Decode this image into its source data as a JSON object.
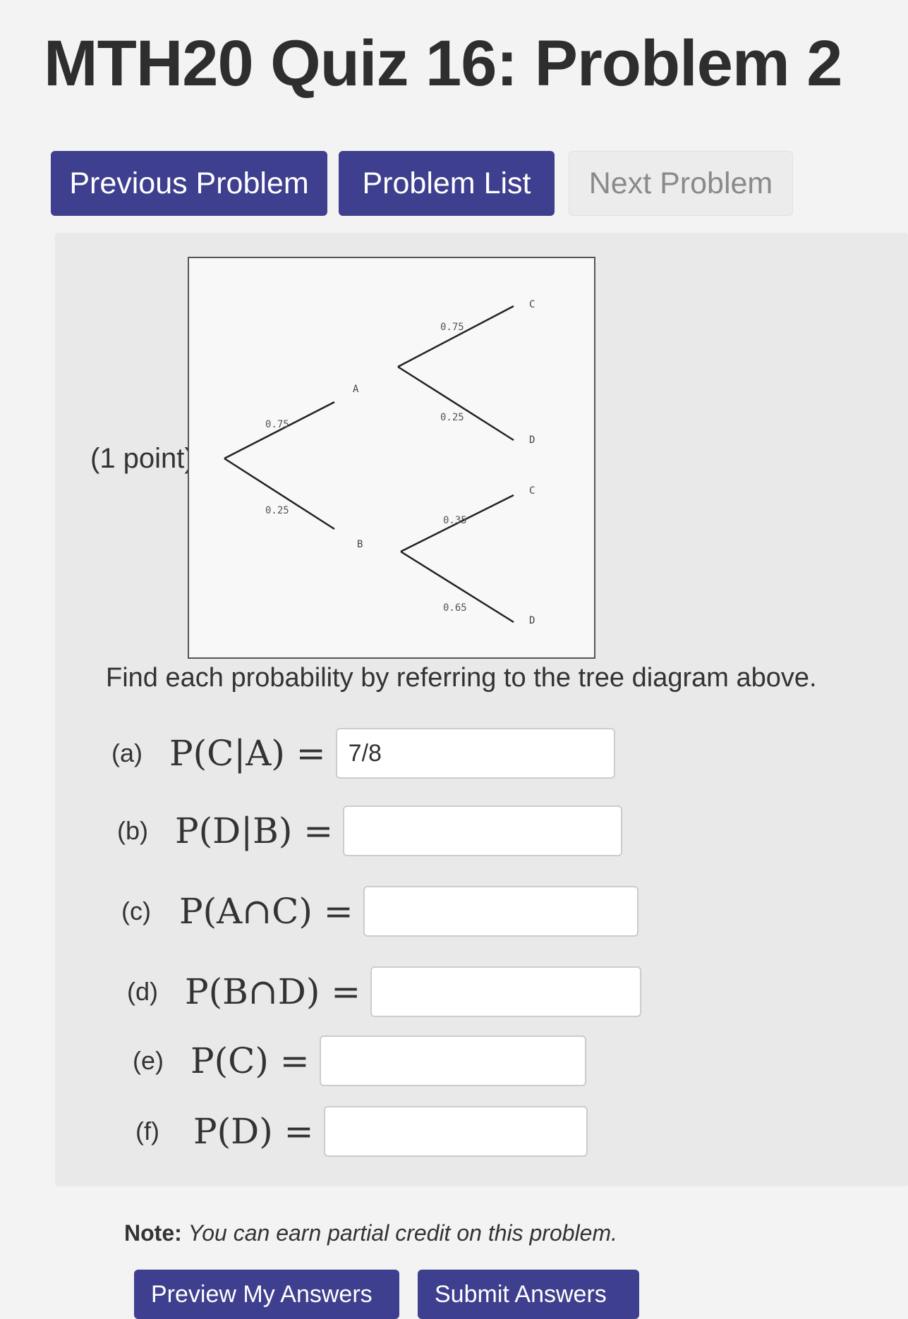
{
  "page": {
    "title": "MTH20 Quiz 16: Problem 2"
  },
  "nav": {
    "previous_label": "Previous Problem",
    "list_label": "Problem List",
    "next_label": "Next Problem"
  },
  "problem": {
    "points": "(1 point)",
    "prompt": "Find each probability by referring to the tree diagram above.",
    "tree": {
      "first_level": [
        {
          "node": "A",
          "prob": "0.75"
        },
        {
          "node": "B",
          "prob": "0.25"
        }
      ],
      "second_level_A": [
        {
          "node": "C",
          "prob": "0.75"
        },
        {
          "node": "D",
          "prob": "0.25"
        }
      ],
      "second_level_B": [
        {
          "node": "C",
          "prob": "0.35"
        },
        {
          "node": "D",
          "prob": "0.65"
        }
      ]
    },
    "questions": [
      {
        "label": "(a)",
        "expr": "P(C|A) =",
        "value": "7/8"
      },
      {
        "label": "(b)",
        "expr": "P(D|B) =",
        "value": ""
      },
      {
        "label": "(c)",
        "expr": "P(A∩C) =",
        "value": ""
      },
      {
        "label": "(d)",
        "expr": "P(B∩D) =",
        "value": ""
      },
      {
        "label": "(e)",
        "expr": "P(C) =",
        "value": ""
      },
      {
        "label": "(f)",
        "expr": "P(D) =",
        "value": ""
      }
    ]
  },
  "note": {
    "label": "Note:",
    "text": "You can earn partial credit on this problem."
  },
  "buttons": {
    "preview_label": "Preview My Answers",
    "submit_label": "Submit Answers"
  }
}
